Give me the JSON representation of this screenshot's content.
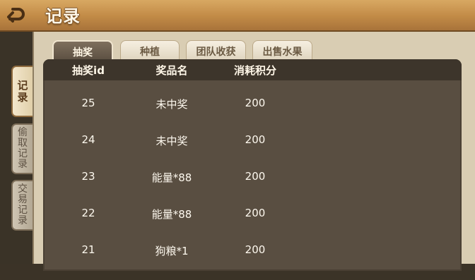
{
  "header": {
    "title": "记录",
    "back_icon": "back-arrow-icon"
  },
  "sidebar": {
    "tabs": [
      {
        "label": [
          "记",
          "录"
        ],
        "active": true
      },
      {
        "label": [
          "偷",
          "取",
          "记",
          "录"
        ],
        "active": false
      },
      {
        "label": [
          "交",
          "易",
          "记",
          "录"
        ],
        "active": false
      }
    ]
  },
  "top_tabs": [
    {
      "label": "抽奖",
      "active": true
    },
    {
      "label": "种植",
      "active": false
    },
    {
      "label": "团队收获",
      "active": false
    },
    {
      "label": "出售水果",
      "active": false
    }
  ],
  "table": {
    "columns": [
      "抽奖id",
      "奖品名",
      "消耗积分"
    ],
    "rows": [
      [
        "25",
        "未中奖",
        "200"
      ],
      [
        "24",
        "未中奖",
        "200"
      ],
      [
        "23",
        "能量*88",
        "200"
      ],
      [
        "22",
        "能量*88",
        "200"
      ],
      [
        "21",
        "狗粮*1",
        "200"
      ]
    ]
  },
  "colors": {
    "header_bar": "#c18a46",
    "panel_bg": "#d9cdb3",
    "content_bg": "#594e41",
    "table_header_bg": "#3d352b",
    "text_light": "#fdf8ee"
  }
}
